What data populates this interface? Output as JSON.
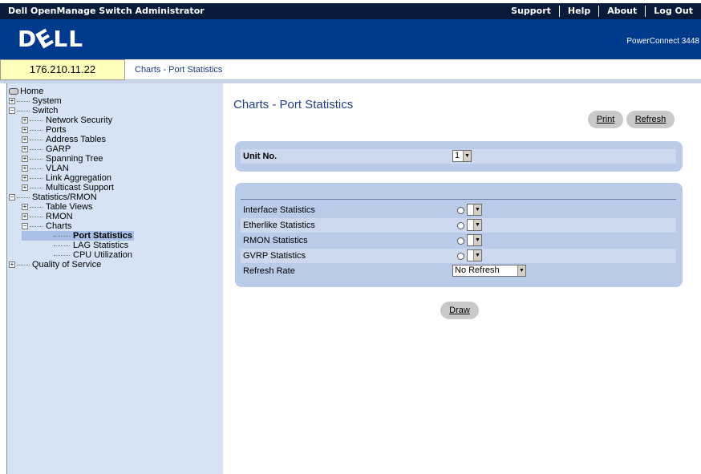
{
  "header": {
    "app_title": "Dell OpenManage Switch Administrator",
    "nav": [
      "Support",
      "Help",
      "About",
      "Log Out"
    ],
    "logo_text": "DELL",
    "model": "PowerConnect 3448",
    "ip_address": "176.210.11.22",
    "breadcrumb": "Charts - Port Statistics"
  },
  "sidebar": {
    "home": "Home",
    "items": [
      {
        "label": "System"
      },
      {
        "label": "Switch"
      },
      {
        "label": "Network Security"
      },
      {
        "label": "Ports"
      },
      {
        "label": "Address Tables"
      },
      {
        "label": "GARP"
      },
      {
        "label": "Spanning Tree"
      },
      {
        "label": "VLAN"
      },
      {
        "label": "Link Aggregation"
      },
      {
        "label": "Multicast Support"
      },
      {
        "label": "Statistics/RMON"
      },
      {
        "label": "Table Views"
      },
      {
        "label": "RMON"
      },
      {
        "label": "Charts"
      },
      {
        "label": "Port Statistics"
      },
      {
        "label": "LAG Statistics"
      },
      {
        "label": "CPU Utilization"
      },
      {
        "label": "Quality of Service"
      }
    ]
  },
  "main": {
    "title": "Charts - Port Statistics",
    "print_label": "Print",
    "refresh_label": "Refresh",
    "unit_label": "Unit No.",
    "unit_value": "1",
    "stats": [
      {
        "label": "Interface Statistics"
      },
      {
        "label": "Etherlike Statistics"
      },
      {
        "label": "RMON Statistics"
      },
      {
        "label": "GVRP Statistics"
      }
    ],
    "refresh_rate_label": "Refresh Rate",
    "refresh_rate_value": "No Refresh",
    "draw_label": "Draw"
  },
  "colors": {
    "topbar": "#0a1a3a",
    "banner": "#003a8c",
    "sidebar_bg": "#d6e3f4",
    "panel_bg": "#b9cbe8",
    "title_color": "#1e3f8a"
  }
}
